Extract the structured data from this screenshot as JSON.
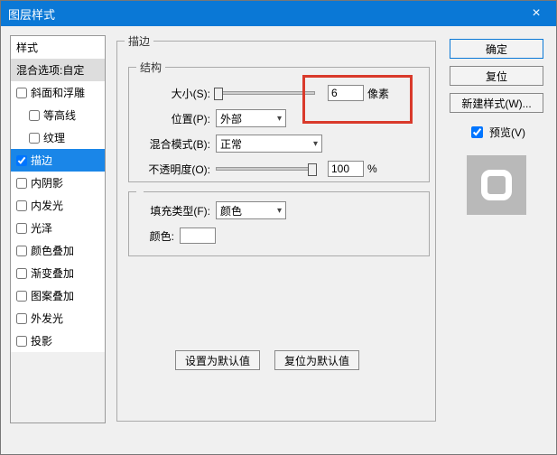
{
  "titlebar": {
    "title": "图层样式",
    "close": "×"
  },
  "stylelist": {
    "head": "样式",
    "blend": "混合选项:自定",
    "items": [
      {
        "label": "斜面和浮雕",
        "indent": false
      },
      {
        "label": "等高线",
        "indent": true
      },
      {
        "label": "纹理",
        "indent": true
      },
      {
        "label": "描边",
        "indent": false,
        "selected": true,
        "checked": true
      },
      {
        "label": "内阴影",
        "indent": false
      },
      {
        "label": "内发光",
        "indent": false
      },
      {
        "label": "光泽",
        "indent": false
      },
      {
        "label": "颜色叠加",
        "indent": false
      },
      {
        "label": "渐变叠加",
        "indent": false
      },
      {
        "label": "图案叠加",
        "indent": false
      },
      {
        "label": "外发光",
        "indent": false
      },
      {
        "label": "投影",
        "indent": false
      }
    ]
  },
  "center": {
    "stroke_legend": "描边",
    "struct_legend": "结构",
    "size_label": "大小(S):",
    "size_value": "6",
    "size_unit": "像素",
    "position_label": "位置(P):",
    "position_value": "外部",
    "blend_label": "混合模式(B):",
    "blend_value": "正常",
    "opacity_label": "不透明度(O):",
    "opacity_value": "100",
    "opacity_unit": "%",
    "filltype_legend": "",
    "filltype_label": "填充类型(F):",
    "filltype_value": "颜色",
    "color_label": "颜色:",
    "btn_set_default": "设置为默认值",
    "btn_reset_default": "复位为默认值"
  },
  "actions": {
    "ok": "确定",
    "reset": "复位",
    "newstyle": "新建样式(W)...",
    "preview_label": "预览(V)"
  }
}
